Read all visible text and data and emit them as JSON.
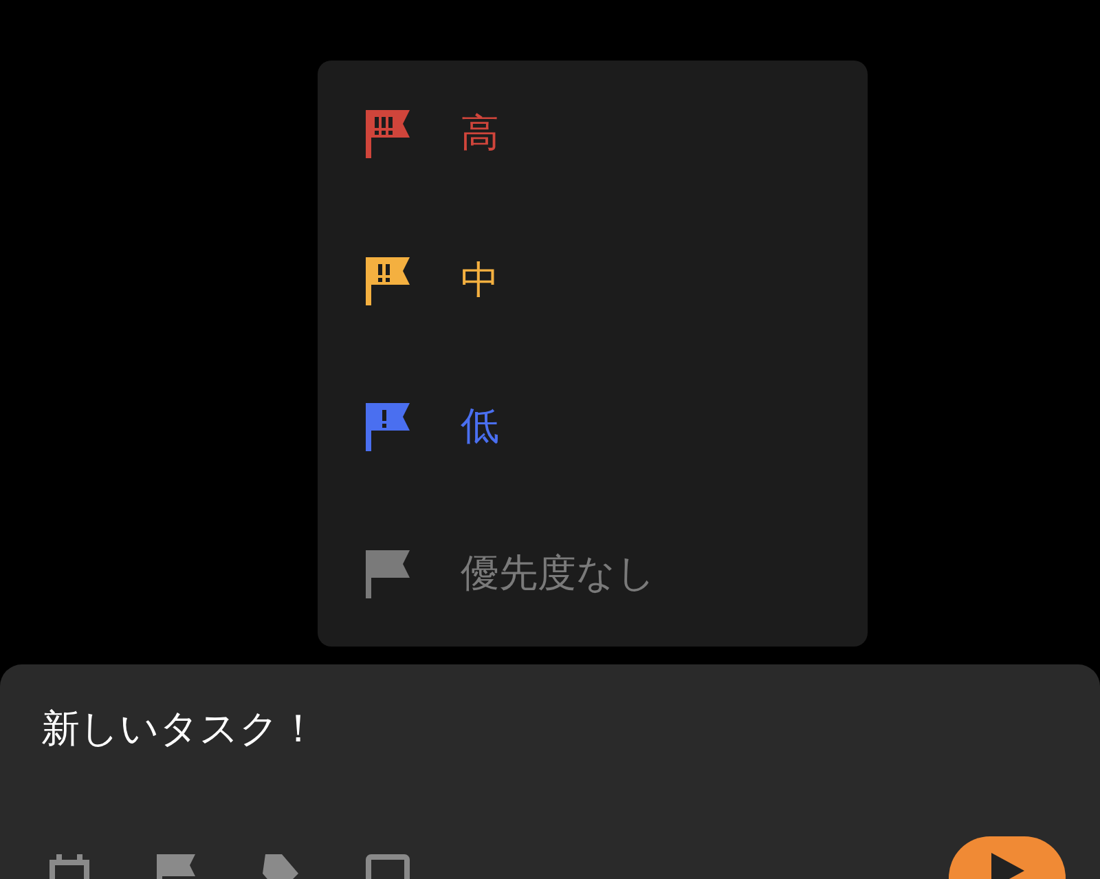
{
  "priority_menu": {
    "items": [
      {
        "kind": "high",
        "label": "高",
        "color": "#d0453b"
      },
      {
        "kind": "medium",
        "label": "中",
        "color": "#f4b040"
      },
      {
        "kind": "low",
        "label": "低",
        "color": "#4a6ff0"
      },
      {
        "kind": "none",
        "label": "優先度なし",
        "color": "#7a7a7a"
      }
    ]
  },
  "task_input": {
    "value": "新しいタスク！"
  }
}
